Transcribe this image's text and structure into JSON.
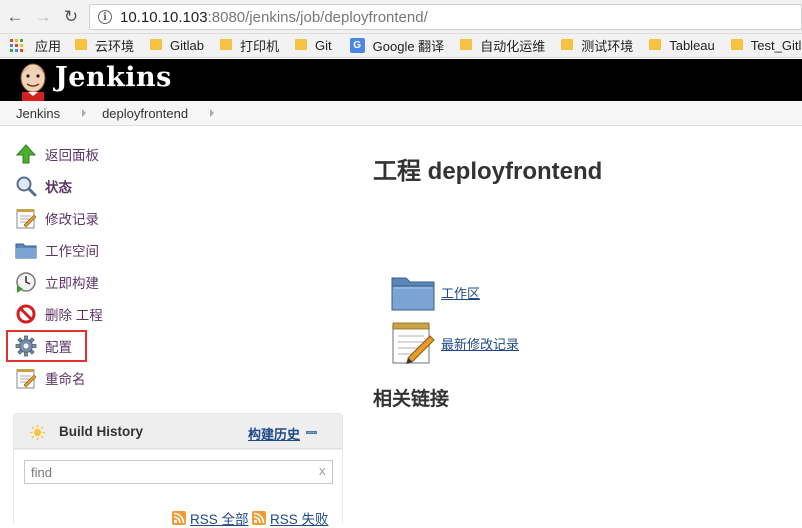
{
  "browser": {
    "url_host": "10.10.10.103",
    "url_rest": ":8080/jenkins/job/deployfrontend/"
  },
  "bookmarks": [
    {
      "label": "应用",
      "icon": "apps-icon"
    },
    {
      "label": "云环境",
      "icon": "folder-icon"
    },
    {
      "label": "Gitlab",
      "icon": "folder-icon"
    },
    {
      "label": "打印机",
      "icon": "folder-icon"
    },
    {
      "label": "Git",
      "icon": "folder-icon"
    },
    {
      "label": "Google 翻译",
      "icon": "google-translate-icon"
    },
    {
      "label": "自动化运维",
      "icon": "folder-icon"
    },
    {
      "label": "测试环境",
      "icon": "folder-icon"
    },
    {
      "label": "Tableau",
      "icon": "folder-icon"
    },
    {
      "label": "Test_Gitlab&",
      "icon": "folder-icon"
    }
  ],
  "header": {
    "title": "Jenkins"
  },
  "breadcrumb": [
    "Jenkins",
    "deployfrontend"
  ],
  "tasks": [
    {
      "label": "返回面板",
      "icon": "up-arrow-icon"
    },
    {
      "label": "状态",
      "icon": "magnifier-icon"
    },
    {
      "label": "修改记录",
      "icon": "notepad-icon"
    },
    {
      "label": "工作空间",
      "icon": "folder-icon"
    },
    {
      "label": "立即构建",
      "icon": "clock-icon"
    },
    {
      "label": "删除 工程",
      "icon": "no-entry-icon"
    },
    {
      "label": "配置",
      "icon": "gear-icon"
    },
    {
      "label": "重命名",
      "icon": "notepad-icon"
    }
  ],
  "build_history": {
    "title": "Build History",
    "trend_label": "构建历史",
    "search_value": "find",
    "clear_label": "x",
    "rss_all": "RSS 全部",
    "rss_failed": "RSS 失败"
  },
  "main": {
    "title": "工程 deployfrontend",
    "workspace_link": "工作区",
    "changes_link": "最新修改记录",
    "related_heading": "相关链接"
  },
  "colors": {
    "task_link": "#5c3566",
    "link_blue": "#204a87",
    "highlight_red": "#e03030"
  }
}
